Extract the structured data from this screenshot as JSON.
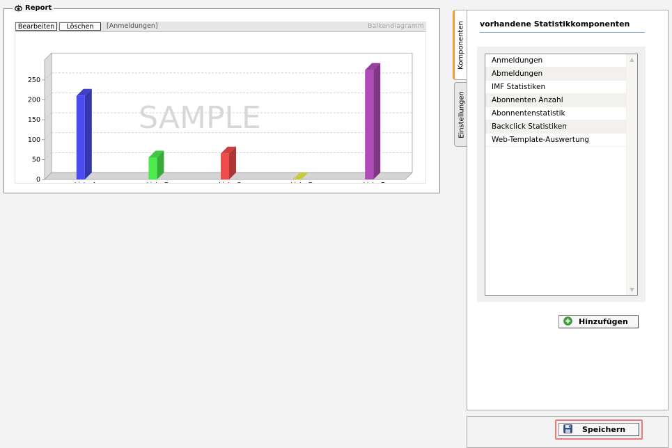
{
  "report": {
    "legend": "Report",
    "toolbar": {
      "edit_label": "Bearbeiten",
      "delete_label": "Löschen",
      "context_label": "[Anmeldungen]",
      "chart_type_label": "Balkendiagramm"
    },
    "watermark": "SAMPLE"
  },
  "chart_data": {
    "type": "bar",
    "categories": [
      "Liste A",
      "Liste B",
      "Liste C",
      "Liste D",
      "Liste E"
    ],
    "values": [
      210,
      55,
      65,
      0,
      275
    ],
    "colors": [
      "#4b4bef",
      "#4cec4c",
      "#ee4c4c",
      "#ecec4c",
      "#b04cb8"
    ],
    "title": "",
    "xlabel": "",
    "ylabel": "",
    "ylim": [
      0,
      300
    ],
    "yticks": [
      0,
      50,
      100,
      150,
      200,
      250
    ],
    "grid": true,
    "legend": false
  },
  "tabs": {
    "components": "Komponenten",
    "settings": "Einstellungen"
  },
  "panel": {
    "title": "vorhandene Statistikkomponenten",
    "items": [
      "Anmeldungen",
      "Abmeldungen",
      "IMF Statistiken",
      "Abonnenten Anzahl",
      "Abonnentenstatistik",
      "Backclick Statistiken",
      "Web-Template-Auswertung"
    ],
    "add_label": "Hinzufügen"
  },
  "footer": {
    "save_label": "Speichern"
  },
  "icons": {
    "report": "eye-icon",
    "add": "plus-circle-icon",
    "save": "floppy-disk-icon"
  }
}
